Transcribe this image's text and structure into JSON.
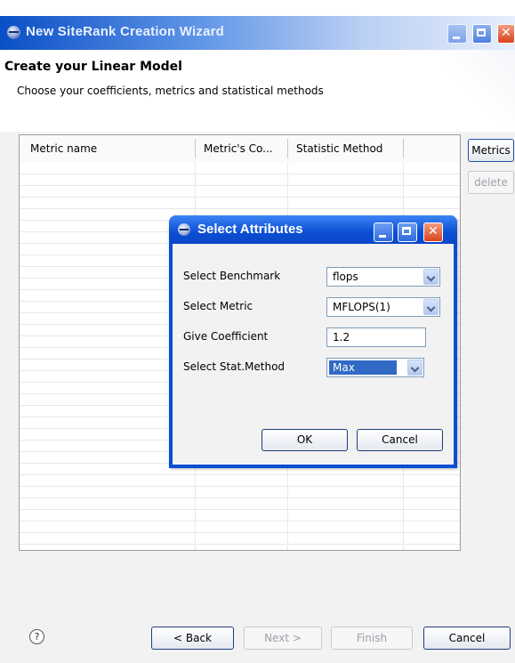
{
  "window": {
    "title": "New SiteRank Creation Wizard",
    "header_title": "Create your Linear Model",
    "header_description": "Choose your coefficients, metrics and statistical methods"
  },
  "table": {
    "columns": [
      "Metric name",
      "Metric's Co...",
      "Statistic Method"
    ]
  },
  "side_buttons": {
    "metrics": "Metrics",
    "delete": "delete"
  },
  "footer": {
    "help": "?",
    "back": "< Back",
    "next": "Next >",
    "finish": "Finish",
    "cancel": "Cancel"
  },
  "dialog": {
    "title": "Select Attributes",
    "fields": {
      "benchmark": {
        "label": "Select Benchmark",
        "value": "flops"
      },
      "metric": {
        "label": "Select Metric",
        "value": "MFLOPS(1)"
      },
      "coefficient": {
        "label": "Give Coefficient",
        "value": "1.2"
      },
      "stat_method": {
        "label": "Select Stat.Method",
        "value": "Max"
      }
    },
    "ok": "OK",
    "cancel": "Cancel"
  },
  "colors": {
    "titlebar_blue": "#0a4fc6",
    "selection_blue": "#316ac5",
    "close_red": "#d9441d"
  }
}
